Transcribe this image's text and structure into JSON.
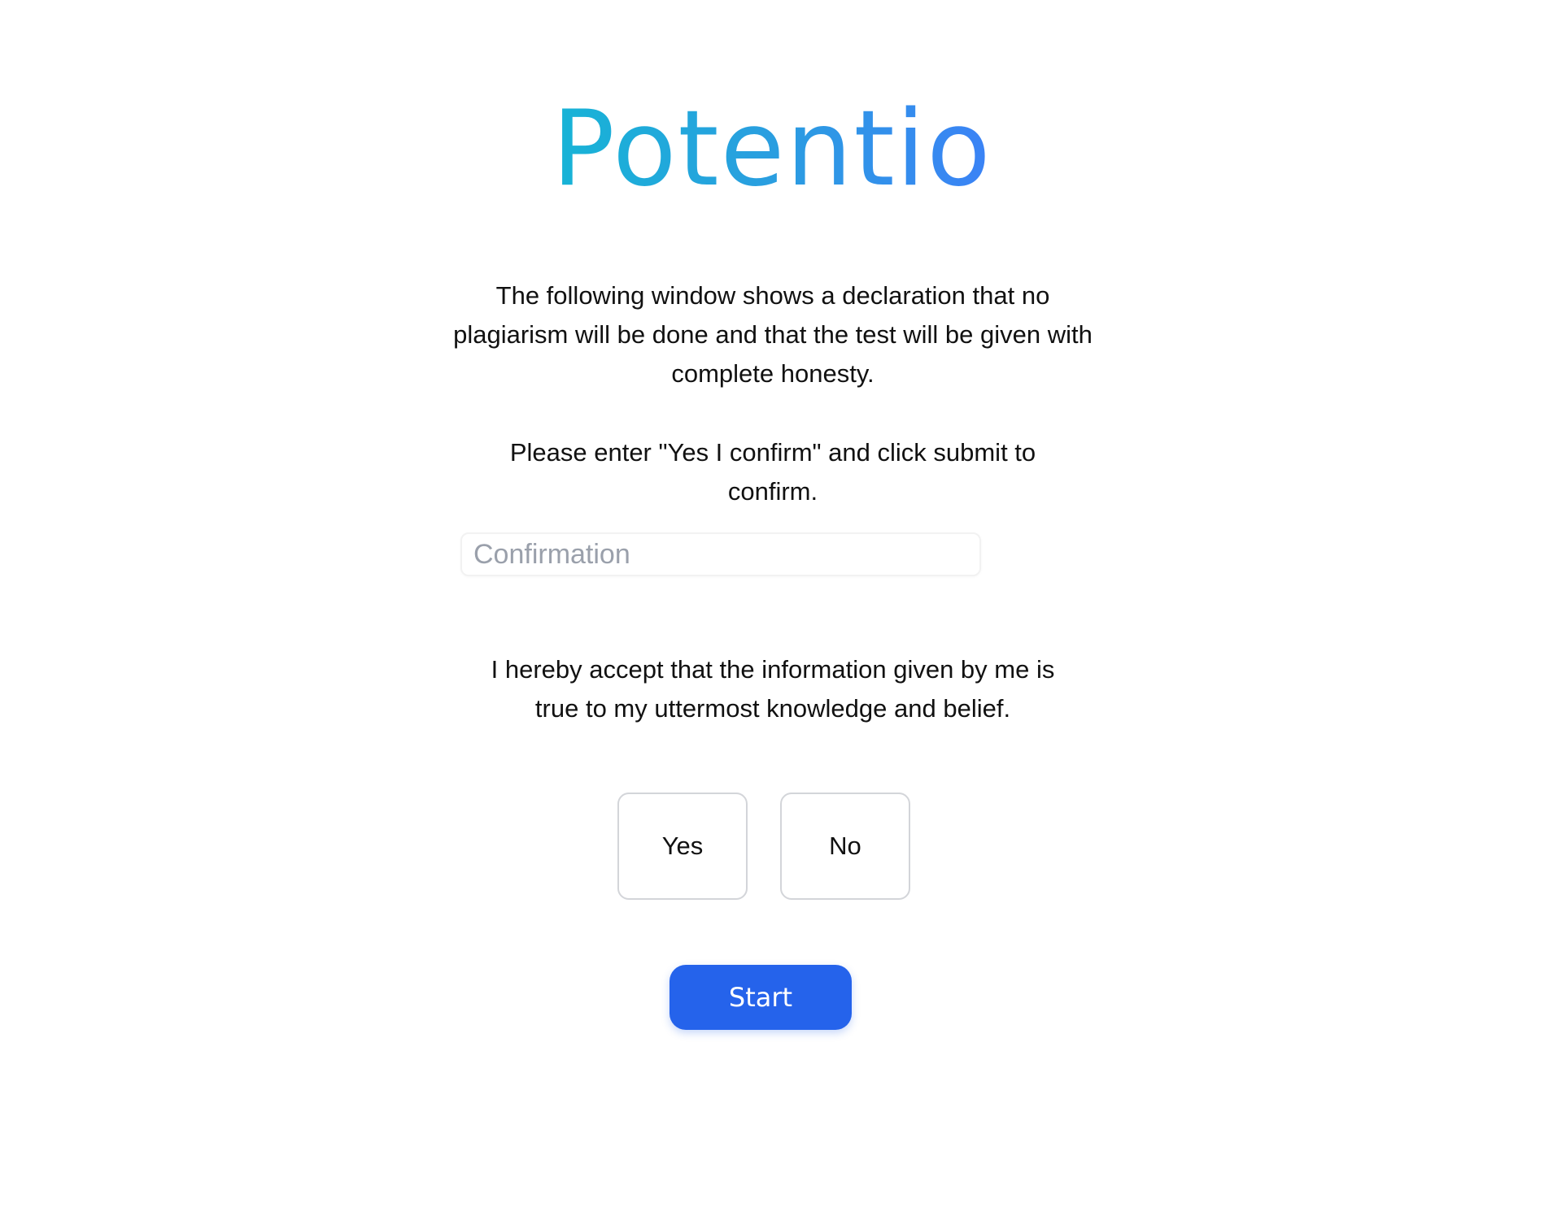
{
  "brand": {
    "name": "Potentio",
    "gradient_start": "#17b4d6",
    "gradient_end": "#3b82f6"
  },
  "declaration": {
    "intro": "The following window shows a declaration that no plagiarism will be done and that the test will be given with complete honesty.",
    "instruction": "Please enter \"Yes I confirm\" and click submit to confirm.",
    "confirmation_input": {
      "value": "",
      "placeholder": "Confirmation"
    },
    "acceptance": "I hereby accept that the information given by me is true to my uttermost knowledge and belief."
  },
  "choices": {
    "yes_label": "Yes",
    "no_label": "No"
  },
  "actions": {
    "start_label": "Start",
    "start_color": "#2563eb"
  }
}
